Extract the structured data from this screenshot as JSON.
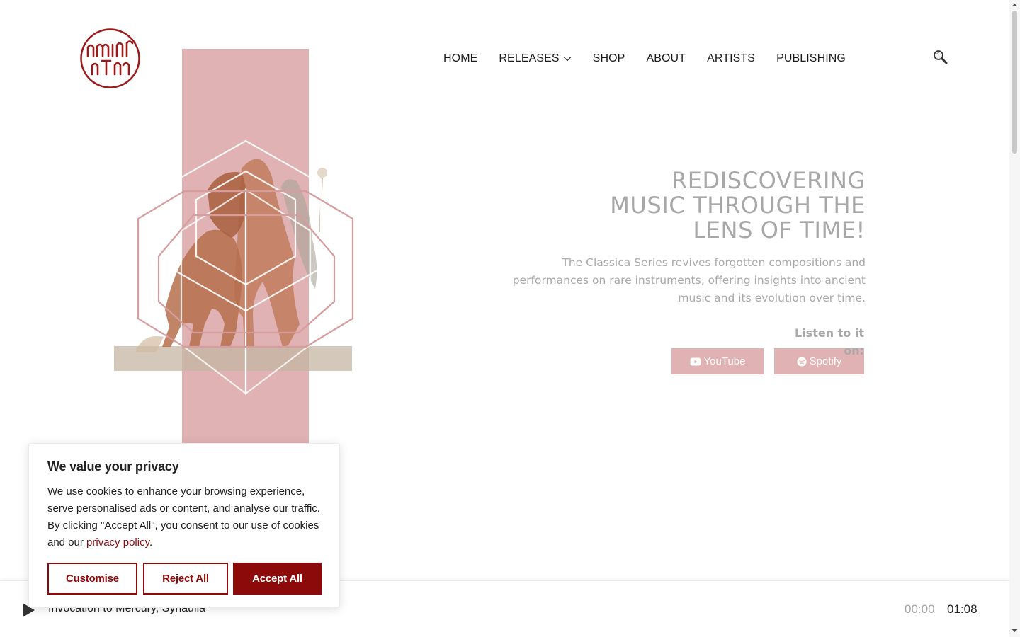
{
  "header": {
    "logo_icon": "amphion-logo",
    "nav": [
      {
        "label": "HOME"
      },
      {
        "label": "RELEASES",
        "has_dropdown": true
      },
      {
        "label": "SHOP"
      },
      {
        "label": "ABOUT"
      },
      {
        "label": "ARTISTS"
      },
      {
        "label": "PUBLISHING"
      }
    ],
    "search_icon": "search-icon"
  },
  "hero": {
    "title": "REDISCOVERING\nMUSIC THROUGH THE\nLENS OF TIME!",
    "description": "The Classica Series revives forgotten compositions and performances on rare instruments, offering insights into ancient music and its evolution over time.",
    "listen_label": "Listen to it on:",
    "buttons": {
      "youtube": "YouTube",
      "spotify": "Spotify"
    }
  },
  "player": {
    "track_title": "Invocation to Mercury, Synaulia",
    "time_current": "00:00",
    "time_total": "01:08"
  },
  "cookie_banner": {
    "title": "We value your privacy",
    "text_before_link": "We use cookies to enhance your browsing experience, serve personalised ads or content, and analyse our traffic. By clicking \"Accept All\", you consent to our use of cookies and our ",
    "link_text": "privacy policy",
    "text_after_link": ".",
    "customise": "Customise",
    "reject": "Reject All",
    "accept": "Accept All"
  },
  "colors": {
    "brand_red": "#8d0a0a",
    "hero_pink": "#e0b2b3",
    "muted_text": "#a9a9a9"
  }
}
